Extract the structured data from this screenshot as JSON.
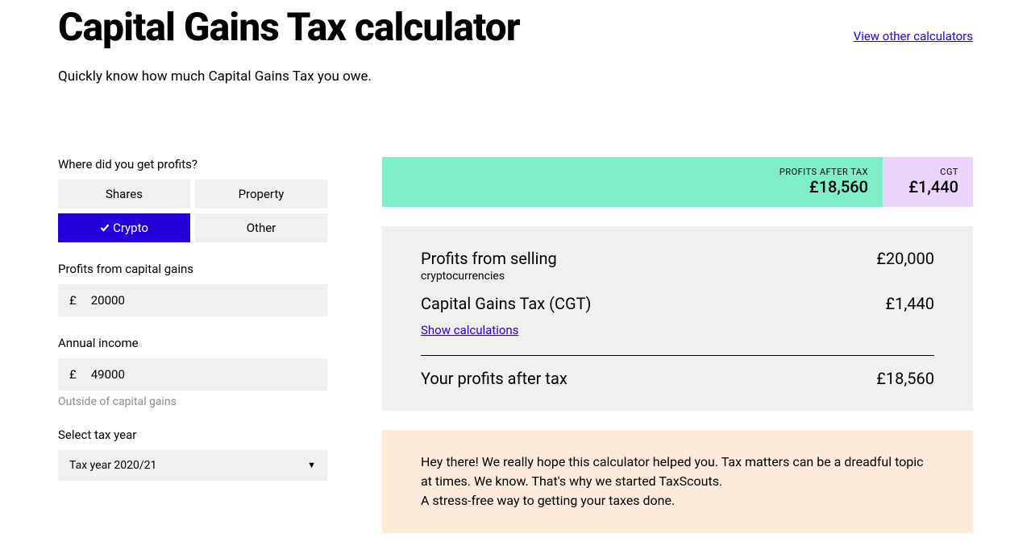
{
  "header": {
    "title": "Capital Gains Tax calculator",
    "other_link": "View other calculators",
    "subtitle": "Quickly know how much Capital Gains Tax you owe."
  },
  "form": {
    "profit_source_label": "Where did you get profits?",
    "sources": {
      "shares": "Shares",
      "property": "Property",
      "crypto": "Crypto",
      "other": "Other"
    },
    "selected_source": "crypto",
    "profits_label": "Profits from capital gains",
    "profits_value": "20000",
    "currency_symbol": "£",
    "income_label": "Annual income",
    "income_value": "49000",
    "income_helper": "Outside of capital gains",
    "tax_year_label": "Select tax year",
    "tax_year_value": "Tax year 2020/21"
  },
  "summary": {
    "profits_label": "PROFITS AFTER TAX",
    "profits_value": "£18,560",
    "cgt_label": "CGT",
    "cgt_value": "£1,440"
  },
  "breakdown": {
    "selling_label": "Profits from selling",
    "selling_sublabel": "cryptocurrencies",
    "selling_value": "£20,000",
    "cgt_label": "Capital Gains Tax (CGT)",
    "cgt_value": "£1,440",
    "show_calc": "Show calculations",
    "after_tax_label": "Your profits after tax",
    "after_tax_value": "£18,560"
  },
  "promo": {
    "line1": "Hey there! We really hope this calculator helped you. Tax matters can be a dreadful topic at times. We know. That's why we started TaxScouts.",
    "line2": "A stress-free way to getting your taxes done."
  }
}
